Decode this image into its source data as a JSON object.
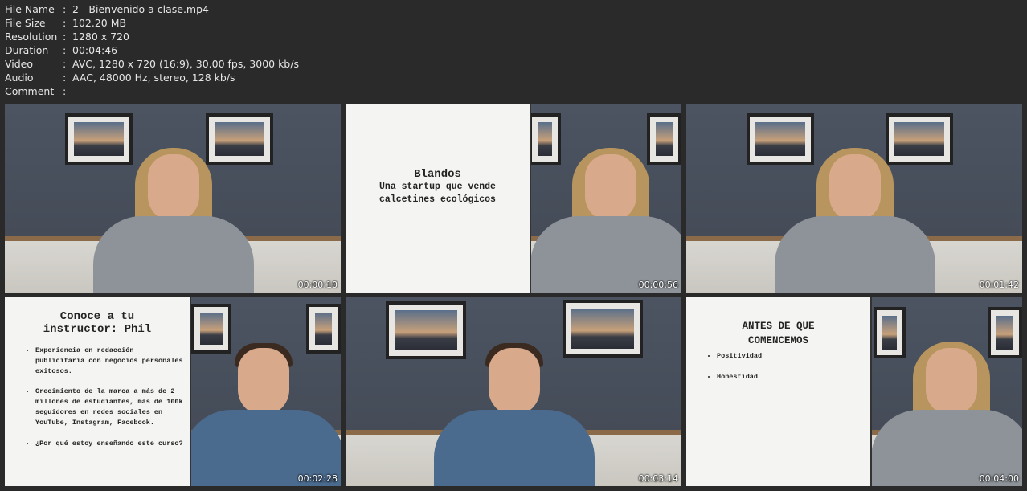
{
  "info": [
    {
      "key": "File Name",
      "value": "2 - Bienvenido a clase.mp4"
    },
    {
      "key": "File Size",
      "value": "102.20 MB"
    },
    {
      "key": "Resolution",
      "value": "1280 x 720"
    },
    {
      "key": "Duration",
      "value": "00:04:46"
    },
    {
      "key": "Video",
      "value": "AVC, 1280 x 720 (16:9), 30.00 fps, 3000 kb/s"
    },
    {
      "key": "Audio",
      "value": "AAC, 48000 Hz, stereo, 128 kb/s"
    },
    {
      "key": "Comment",
      "value": ""
    }
  ],
  "separator": ":",
  "thumbs": [
    {
      "time": "00:00:10"
    },
    {
      "time": "00:00:56",
      "slide": {
        "title": "Blandos",
        "subtitle": "Una startup que vende calcetines ecológicos"
      }
    },
    {
      "time": "00:01:42"
    },
    {
      "time": "00:02:28",
      "slide": {
        "title": "Conoce a tu instructor: Phil",
        "bullets": [
          "Experiencia en redacción publicitaria con negocios personales exitosos.",
          "Crecimiento de la marca a más de 2 millones de estudiantes, más de 100k seguidores en redes sociales en YouTube, Instagram, Facebook.",
          "¿Por qué estoy enseñando este curso?"
        ]
      }
    },
    {
      "time": "00:03:14"
    },
    {
      "time": "00:04:00",
      "slide": {
        "title": "ANTES DE QUE COMENCEMOS",
        "bullets": [
          "Positividad",
          "Honestidad"
        ]
      }
    }
  ]
}
